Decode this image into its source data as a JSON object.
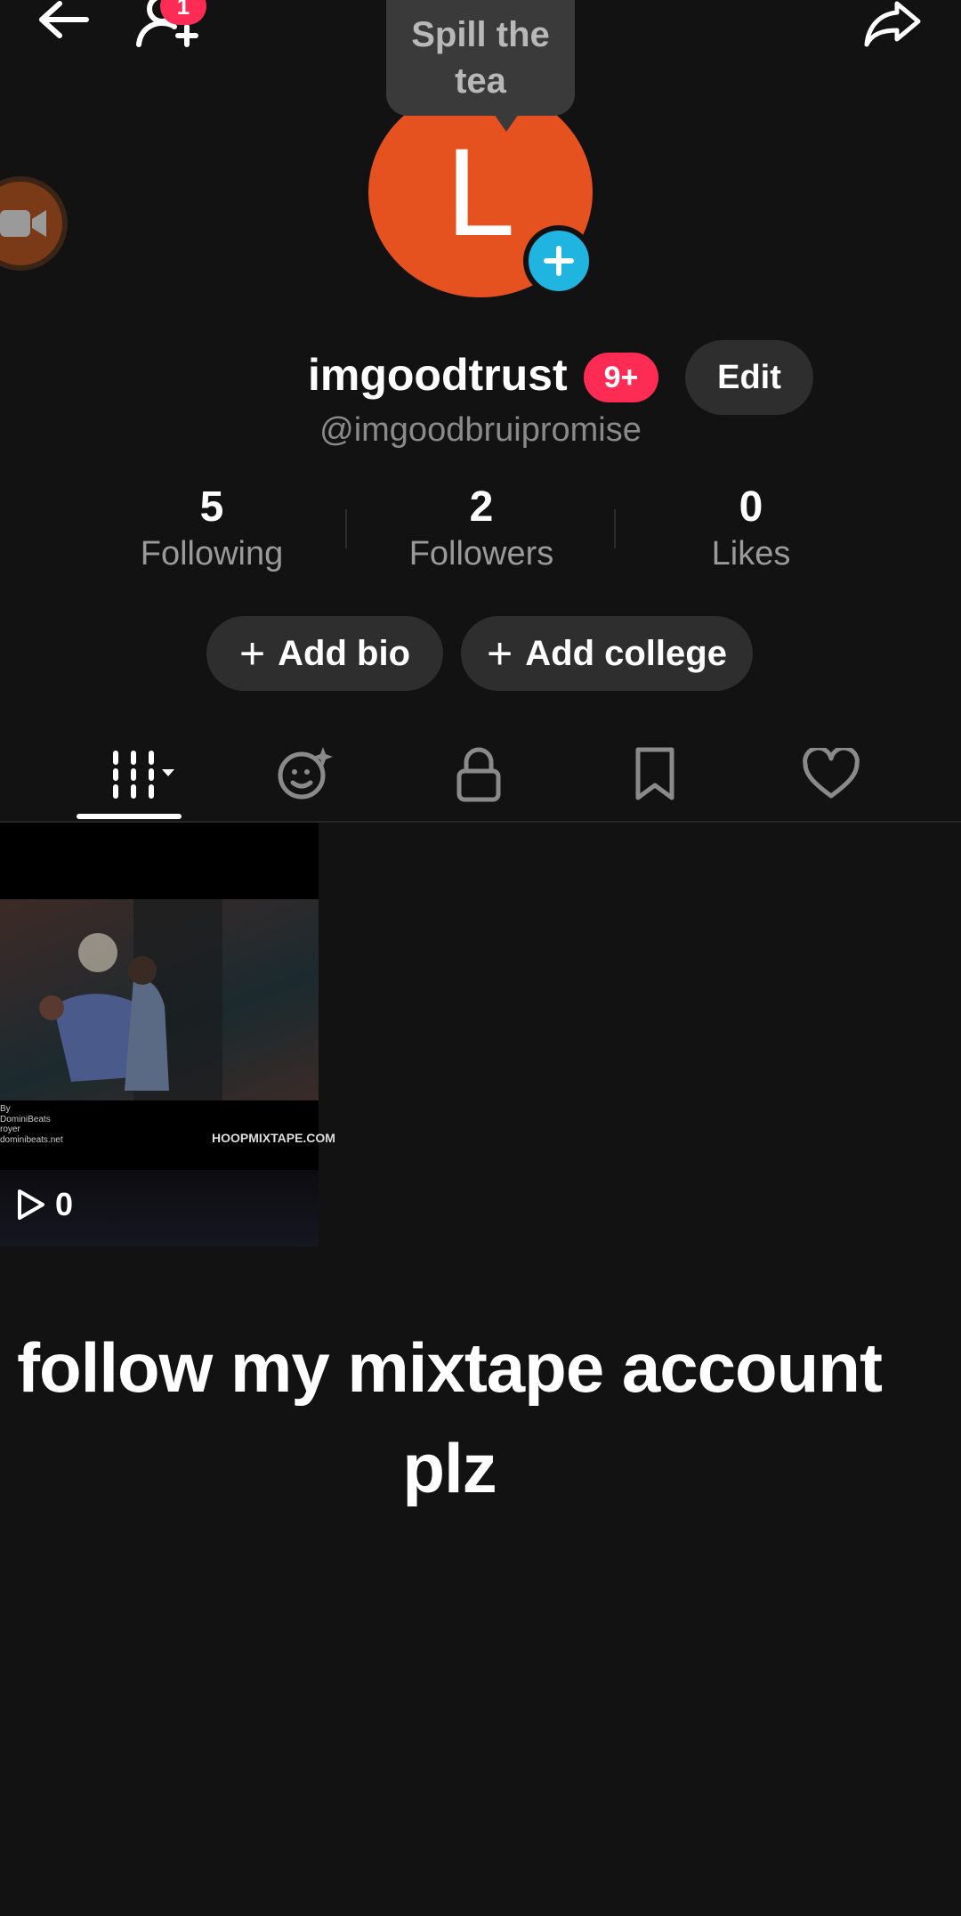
{
  "header": {
    "back_icon": "arrow-left-icon",
    "add_friend_icon": "person-plus-icon",
    "share_icon": "share-arrow-icon",
    "notif_count": "1"
  },
  "tooltip": {
    "text": "Spill the\ntea"
  },
  "avatar": {
    "letter": "L",
    "color": "#e6521f",
    "plus_color": "#1fb5e0"
  },
  "profile": {
    "display_name": "imgoodtrust",
    "badge": "9+",
    "edit_label": "Edit",
    "handle": "@imgoodbruipromise"
  },
  "stats": [
    {
      "value": "5",
      "label": "Following"
    },
    {
      "value": "2",
      "label": "Followers"
    },
    {
      "value": "0",
      "label": "Likes"
    }
  ],
  "actions": {
    "add_bio": "Add bio",
    "add_college": "Add college"
  },
  "tabs": [
    {
      "icon": "grid-videos-icon",
      "active": true
    },
    {
      "icon": "face-sparkle-icon",
      "active": false
    },
    {
      "icon": "lock-icon",
      "active": false
    },
    {
      "icon": "bookmark-icon",
      "active": false
    },
    {
      "icon": "heart-icon",
      "active": false
    }
  ],
  "video": {
    "views": "0",
    "watermark": "HOOPMIXTAPE.COM",
    "credit": "By\nDominiBeats\nroyer\ndominibeats.net"
  },
  "caption": {
    "text": "follow my mixtape account plz"
  },
  "colors": {
    "background": "#121212",
    "accent_red": "#fe2c55",
    "pill": "#2e2e2e"
  }
}
